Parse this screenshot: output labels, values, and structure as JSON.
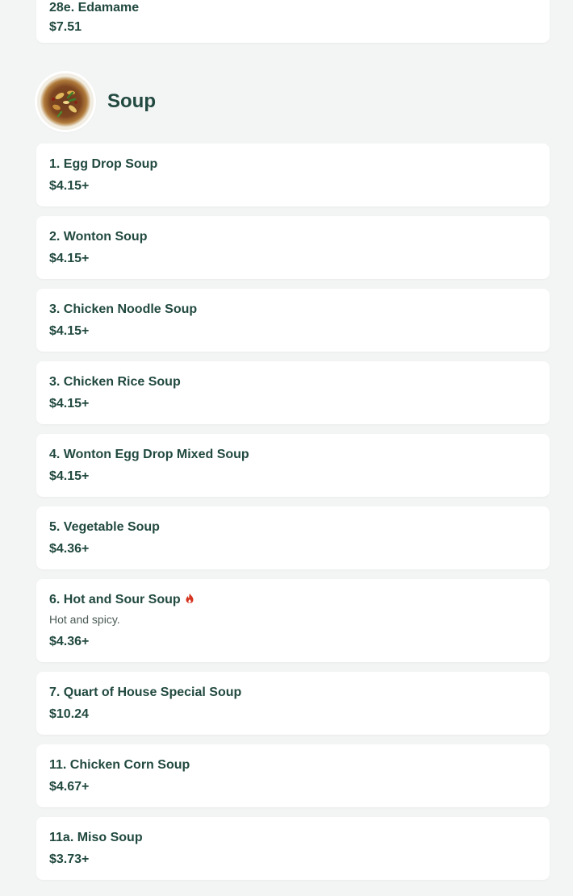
{
  "colors": {
    "background": "#f3f4f4",
    "card": "#ffffff",
    "text_primary": "#21493f",
    "text_secondary": "#4b5b56",
    "spicy": "#d5351f"
  },
  "previous_item": {
    "name": "28e. Edamame",
    "price": "$7.51"
  },
  "section": {
    "title": "Soup",
    "thumbnail_icon": "soup-bowl-image"
  },
  "items": [
    {
      "name": "1. Egg Drop Soup",
      "price": "$4.15+"
    },
    {
      "name": "2. Wonton Soup",
      "price": "$4.15+"
    },
    {
      "name": "3. Chicken Noodle Soup",
      "price": "$4.15+"
    },
    {
      "name": "3. Chicken Rice Soup",
      "price": "$4.15+"
    },
    {
      "name": "4. Wonton Egg Drop Mixed Soup",
      "price": "$4.15+"
    },
    {
      "name": "5. Vegetable Soup",
      "price": "$4.36+"
    },
    {
      "name": "6. Hot and Sour Soup",
      "description": "Hot and spicy.",
      "price": "$4.36+",
      "icon": "spicy-flame-icon"
    },
    {
      "name": "7. Quart of House Special Soup",
      "price": "$10.24"
    },
    {
      "name": "11. Chicken Corn Soup",
      "price": "$4.67+"
    },
    {
      "name": "11a. Miso Soup",
      "price": "$3.73+"
    }
  ]
}
